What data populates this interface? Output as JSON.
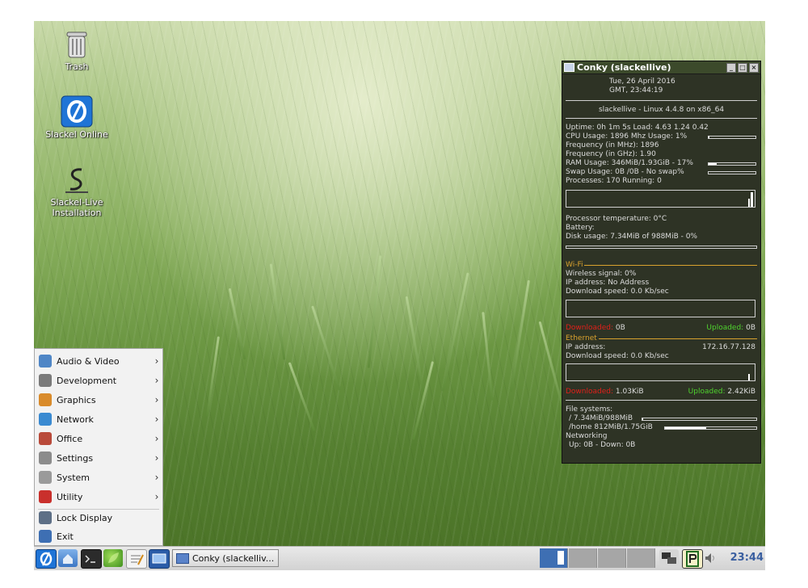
{
  "desktop": {
    "icons": [
      {
        "label": "Trash"
      },
      {
        "label": "Slackel Online"
      },
      {
        "label": "Slackel-Live Installation"
      }
    ]
  },
  "conky": {
    "title": "Conky (slackellive)",
    "date": "Tue,   26 April 2016",
    "time": "GMT,     23:44:19",
    "system": "slackellive - Linux 4.4.8 on x86_64",
    "uptime": "Uptime: 0h 1m 5s Load: 4.63 1.24 0.42",
    "cpu_usage": "CPU Usage:  1896 Mhz  Usage: 1%",
    "freq_mhz": "Frequency (in MHz):  1896",
    "freq_ghz": "Frequency (in GHz):  1.90",
    "ram_usage": "RAM Usage:  346MiB/1.93GiB - 17%",
    "swap_usage": "Swap Usage:  0B  /0B   - No swap%",
    "processes": "Processes:  170   Running:  0",
    "cpu_level": 0.01,
    "ram_level": 0.17,
    "swap_level": 0,
    "proc_temp": "Processor temperature: 0°C",
    "battery": "Battery:",
    "disk_usage": "Disk usage: 7.34MiB of 988MiB - 0%",
    "disk_level": 0.0,
    "wifi_header": "Wi-Fi",
    "wireless_signal": "Wireless signal: 0%",
    "wifi_ip": "IP address: No Address",
    "wifi_download": "Download speed: 0.0 Kb/sec",
    "wifi_downloaded_label": "Downloaded:",
    "wifi_downloaded_value": "0B",
    "wifi_uploaded_label": "Uploaded:",
    "wifi_uploaded_value": "0B",
    "eth_header": "Ethernet",
    "eth_ip_label": "IP address:",
    "eth_ip_value": "172.16.77.128",
    "eth_download": "Download speed: 0.0 Kb/sec",
    "eth_downloaded_label": "Downloaded:",
    "eth_downloaded_value": "1.03KiB",
    "eth_uploaded_label": "Uploaded:",
    "eth_uploaded_value": "2.42KiB",
    "fs_header": "File systems:",
    "fs_root": "/ 7.34MiB/988MiB",
    "fs_root_level": 0.01,
    "fs_home": "/home 812MiB/1.75GiB",
    "fs_home_level": 0.45,
    "networking_header": "Networking",
    "networking_line": "Up: 0B    - Down: 0B"
  },
  "menu": {
    "items": [
      {
        "label": "Audio & Video",
        "chevron": "›",
        "icon": "audio-video-icon",
        "color": "#4f86c6"
      },
      {
        "label": "Development",
        "chevron": "›",
        "icon": "development-icon",
        "color": "#7a7a7a"
      },
      {
        "label": "Graphics",
        "chevron": "›",
        "icon": "graphics-icon",
        "color": "#d98b2b"
      },
      {
        "label": "Network",
        "chevron": "›",
        "icon": "network-icon",
        "color": "#3a8ad1"
      },
      {
        "label": "Office",
        "chevron": "›",
        "icon": "office-icon",
        "color": "#b94a3a"
      },
      {
        "label": "Settings",
        "chevron": "›",
        "icon": "settings-icon",
        "color": "#8c8c8c"
      },
      {
        "label": "System",
        "chevron": "›",
        "icon": "system-icon",
        "color": "#9a9a9a"
      },
      {
        "label": "Utility",
        "chevron": "›",
        "icon": "utility-icon",
        "color": "#c9302c"
      }
    ],
    "lock_display": "Lock Display",
    "exit": "Exit"
  },
  "taskbar": {
    "task_label": "Conky (slackelliv...",
    "clock": "23:44",
    "accent": "#3a5fa0"
  }
}
